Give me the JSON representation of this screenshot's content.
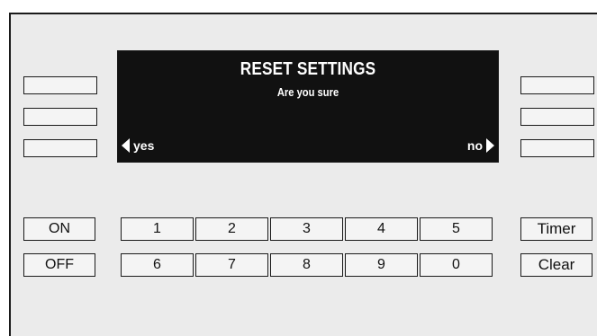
{
  "display": {
    "title": "RESET SETTINGS",
    "subtitle": "Are you sure",
    "left_softkey": "yes",
    "right_softkey": "no"
  },
  "keys": {
    "on": "ON",
    "off": "OFF",
    "timer": "Timer",
    "clear": "Clear",
    "row1": [
      "1",
      "2",
      "3",
      "4",
      "5"
    ],
    "row2": [
      "6",
      "7",
      "8",
      "9",
      "0"
    ]
  }
}
